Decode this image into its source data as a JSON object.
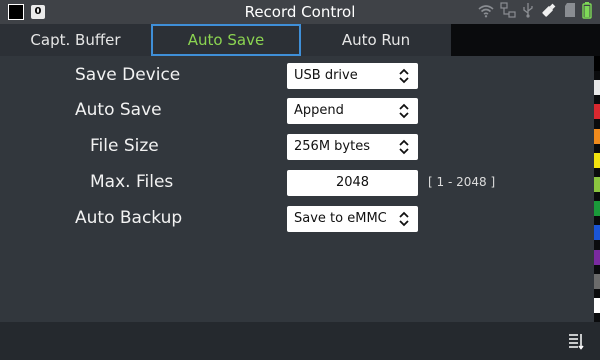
{
  "titlebar": {
    "title": "Record Control",
    "badge": "0",
    "status_icons": [
      "wifi-icon",
      "network-icon",
      "usb-icon",
      "usb-drive-icon",
      "sd-card-icon",
      "battery-icon"
    ],
    "battery_color": "#7ed957"
  },
  "tabs": [
    {
      "label": "Capt. Buffer",
      "selected": false
    },
    {
      "label": "Auto Save",
      "selected": true
    },
    {
      "label": "Auto Run",
      "selected": false
    }
  ],
  "settings": {
    "save_device": {
      "label": "Save Device",
      "value": "USB drive"
    },
    "auto_save": {
      "label": "Auto Save",
      "value": "Append"
    },
    "file_size": {
      "label": "File Size",
      "value": "256M bytes"
    },
    "max_files": {
      "label": "Max. Files",
      "value": "2048",
      "range": "[ 1 - 2048 ]"
    },
    "auto_backup": {
      "label": "Auto Backup",
      "value": "Save to eMMC"
    }
  },
  "channel_colors": [
    "#000000",
    "#e8e8e8",
    "#d9282f",
    "#f08a1c",
    "#f2e20f",
    "#8bc53f",
    "#1a9a3a",
    "#1a55d8",
    "#7a2aa0",
    "#6b6b6b",
    "#ffffff"
  ],
  "accent": {
    "selected_tab_text": "#8bd451",
    "selected_tab_border": "#3f8fd8"
  }
}
